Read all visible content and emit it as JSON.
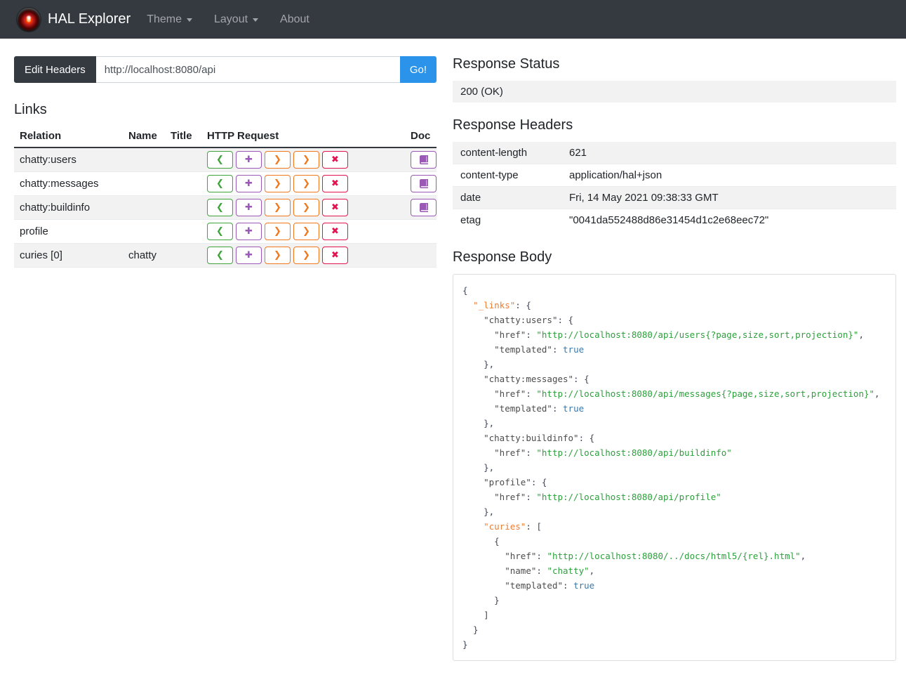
{
  "navbar": {
    "brand": "HAL Explorer",
    "items": [
      {
        "label": "Theme",
        "has_caret": true
      },
      {
        "label": "Layout",
        "has_caret": true
      },
      {
        "label": "About",
        "has_caret": false
      }
    ]
  },
  "request_bar": {
    "edit_headers_label": "Edit Headers",
    "url_value": "http://localhost:8080/api",
    "go_label": "Go!"
  },
  "links_section": {
    "title": "Links",
    "columns": [
      "Relation",
      "Name",
      "Title",
      "HTTP Request",
      "Doc"
    ],
    "http_buttons": [
      {
        "name": "get-button",
        "glyph": "❮",
        "color": "#41a33c"
      },
      {
        "name": "post-button",
        "glyph": "✚",
        "color": "#9b59b6"
      },
      {
        "name": "put-button",
        "glyph": "❯",
        "color": "#f0791f"
      },
      {
        "name": "patch-button",
        "glyph": "❯",
        "color": "#f0791f"
      },
      {
        "name": "delete-button",
        "glyph": "✖",
        "color": "#e2134e"
      }
    ],
    "doc_button_color": "#9b59b6",
    "rows": [
      {
        "relation": "chatty:users",
        "name": "",
        "title": "",
        "doc": true
      },
      {
        "relation": "chatty:messages",
        "name": "",
        "title": "",
        "doc": true
      },
      {
        "relation": "chatty:buildinfo",
        "name": "",
        "title": "",
        "doc": true
      },
      {
        "relation": "profile",
        "name": "",
        "title": "",
        "doc": false
      },
      {
        "relation": "curies [0]",
        "name": "chatty",
        "title": "",
        "doc": false
      }
    ]
  },
  "response_status": {
    "title": "Response Status",
    "value": "200 (OK)"
  },
  "response_headers": {
    "title": "Response Headers",
    "rows": [
      {
        "key": "content-length",
        "value": "621"
      },
      {
        "key": "content-type",
        "value": "application/hal+json"
      },
      {
        "key": "date",
        "value": "Fri, 14 May 2021 09:38:33 GMT"
      },
      {
        "key": "etag",
        "value": "\"0041da552488d86e31454d1c2e68eec72\""
      }
    ]
  },
  "response_body": {
    "title": "Response Body",
    "lines": [
      [
        {
          "t": "{",
          "c": "p"
        }
      ],
      [
        {
          "t": "  ",
          "c": "p"
        },
        {
          "t": "\"_links\"",
          "c": "s"
        },
        {
          "t": ": {",
          "c": "p"
        }
      ],
      [
        {
          "t": "    ",
          "c": "p"
        },
        {
          "t": "\"chatty:users\"",
          "c": "k"
        },
        {
          "t": ": {",
          "c": "p"
        }
      ],
      [
        {
          "t": "      ",
          "c": "p"
        },
        {
          "t": "\"href\"",
          "c": "k"
        },
        {
          "t": ": ",
          "c": "p"
        },
        {
          "t": "\"http://localhost:8080/api/users{?page,size,sort,projection}\"",
          "c": "g"
        },
        {
          "t": ",",
          "c": "p"
        }
      ],
      [
        {
          "t": "      ",
          "c": "p"
        },
        {
          "t": "\"templated\"",
          "c": "k"
        },
        {
          "t": ": ",
          "c": "p"
        },
        {
          "t": "true",
          "c": "b"
        }
      ],
      [
        {
          "t": "    },",
          "c": "p"
        }
      ],
      [
        {
          "t": "    ",
          "c": "p"
        },
        {
          "t": "\"chatty:messages\"",
          "c": "k"
        },
        {
          "t": ": {",
          "c": "p"
        }
      ],
      [
        {
          "t": "      ",
          "c": "p"
        },
        {
          "t": "\"href\"",
          "c": "k"
        },
        {
          "t": ": ",
          "c": "p"
        },
        {
          "t": "\"http://localhost:8080/api/messages{?page,size,sort,projection}\"",
          "c": "g"
        },
        {
          "t": ",",
          "c": "p"
        }
      ],
      [
        {
          "t": "      ",
          "c": "p"
        },
        {
          "t": "\"templated\"",
          "c": "k"
        },
        {
          "t": ": ",
          "c": "p"
        },
        {
          "t": "true",
          "c": "b"
        }
      ],
      [
        {
          "t": "    },",
          "c": "p"
        }
      ],
      [
        {
          "t": "    ",
          "c": "p"
        },
        {
          "t": "\"chatty:buildinfo\"",
          "c": "k"
        },
        {
          "t": ": {",
          "c": "p"
        }
      ],
      [
        {
          "t": "      ",
          "c": "p"
        },
        {
          "t": "\"href\"",
          "c": "k"
        },
        {
          "t": ": ",
          "c": "p"
        },
        {
          "t": "\"http://localhost:8080/api/buildinfo\"",
          "c": "g"
        }
      ],
      [
        {
          "t": "    },",
          "c": "p"
        }
      ],
      [
        {
          "t": "    ",
          "c": "p"
        },
        {
          "t": "\"profile\"",
          "c": "k"
        },
        {
          "t": ": {",
          "c": "p"
        }
      ],
      [
        {
          "t": "      ",
          "c": "p"
        },
        {
          "t": "\"href\"",
          "c": "k"
        },
        {
          "t": ": ",
          "c": "p"
        },
        {
          "t": "\"http://localhost:8080/api/profile\"",
          "c": "g"
        }
      ],
      [
        {
          "t": "    },",
          "c": "p"
        }
      ],
      [
        {
          "t": "    ",
          "c": "p"
        },
        {
          "t": "\"curies\"",
          "c": "s"
        },
        {
          "t": ": [",
          "c": "p"
        }
      ],
      [
        {
          "t": "      {",
          "c": "p"
        }
      ],
      [
        {
          "t": "        ",
          "c": "p"
        },
        {
          "t": "\"href\"",
          "c": "k"
        },
        {
          "t": ": ",
          "c": "p"
        },
        {
          "t": "\"http://localhost:8080/../docs/html5/{rel}.html\"",
          "c": "g"
        },
        {
          "t": ",",
          "c": "p"
        }
      ],
      [
        {
          "t": "        ",
          "c": "p"
        },
        {
          "t": "\"name\"",
          "c": "k"
        },
        {
          "t": ": ",
          "c": "p"
        },
        {
          "t": "\"chatty\"",
          "c": "g"
        },
        {
          "t": ",",
          "c": "p"
        }
      ],
      [
        {
          "t": "        ",
          "c": "p"
        },
        {
          "t": "\"templated\"",
          "c": "k"
        },
        {
          "t": ": ",
          "c": "p"
        },
        {
          "t": "true",
          "c": "b"
        }
      ],
      [
        {
          "t": "      }",
          "c": "p"
        }
      ],
      [
        {
          "t": "    ]",
          "c": "p"
        }
      ],
      [
        {
          "t": "  }",
          "c": "p"
        }
      ],
      [
        {
          "t": "}",
          "c": "p"
        }
      ]
    ]
  },
  "colors": {
    "navbar_bg": "#343a40",
    "go_button": "#2b93e9",
    "stripe": "#f2f2f2",
    "json_special_key": "#ed7d31",
    "json_string": "#2ca03c",
    "json_boolean": "#3878ab"
  }
}
